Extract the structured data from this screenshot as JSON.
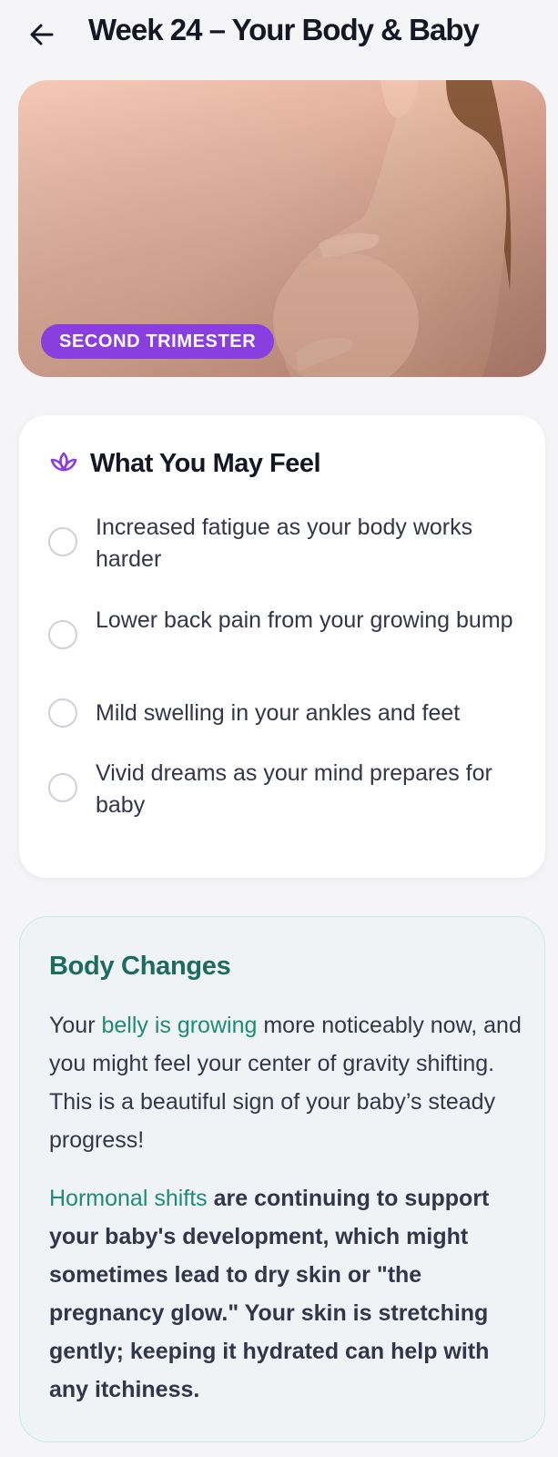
{
  "header": {
    "title": "Week 24 – Your Body & Baby",
    "back_icon": "arrow-left-icon"
  },
  "hero": {
    "badge": "SECOND TRIMESTER",
    "badge_color": "#8a3ee0",
    "image_subject": "pregnant-woman-photo"
  },
  "feel": {
    "title": "What You May Feel",
    "icon": "lotus-icon",
    "icon_color": "#8a3ee0",
    "items": [
      {
        "text": "Increased fatigue as your body works harder",
        "checked": false
      },
      {
        "text": "Lower back pain from your growing bump",
        "checked": false
      },
      {
        "text": "Mild swelling in your ankles and feet",
        "checked": false
      },
      {
        "text": "Vivid dreams as your mind prepares for baby",
        "checked": false
      }
    ]
  },
  "body_changes": {
    "title": "Body Changes",
    "title_color": "#1d6b60",
    "accent_color": "#1f8a78",
    "para1_pre": "Your ",
    "para1_highlight": "belly is growing",
    "para1_post": " more noticeably now, and you might feel your center of gravity shifting. This is a beautiful sign of your baby’s steady progress!",
    "para2_highlight": "Hormonal shifts",
    "para2_post": " are continuing to support your baby's development, which might sometimes lead to dry skin or \"the pregnancy glow.\" Your skin is stretching gently; keeping it hydrated can help with any itchiness."
  }
}
